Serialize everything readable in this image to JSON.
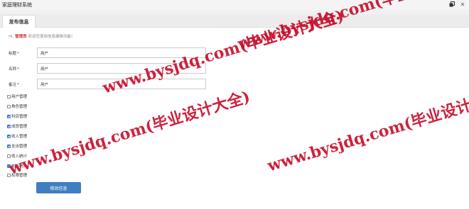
{
  "window": {
    "title": "家庭理财系统"
  },
  "tabs": [
    {
      "label": "发布信息"
    }
  ],
  "greeting": {
    "prefix": "Hi,",
    "username": "管理员",
    "suffix": "欢迎您使用信息编辑功能!"
  },
  "form": {
    "fields": [
      {
        "label": "标题",
        "required_mark": "*",
        "value": "用户"
      },
      {
        "label": "名称",
        "required_mark": "*",
        "value": "用户"
      },
      {
        "label": "备注",
        "required_mark": "*",
        "value": "用户"
      }
    ],
    "permissions": [
      {
        "label": "用户管理",
        "checked": false
      },
      {
        "label": "角色管理",
        "checked": false
      },
      {
        "label": "科目管理",
        "checked": true
      },
      {
        "label": "成员管理",
        "checked": true
      },
      {
        "label": "收入管理",
        "checked": true
      },
      {
        "label": "支出管理",
        "checked": true
      },
      {
        "label": "收入统计",
        "checked": false
      },
      {
        "label": "支出统计",
        "checked": true
      },
      {
        "label": "权限管理",
        "checked": false
      }
    ],
    "submit_label": "修改信息"
  },
  "watermark": {
    "text": "www.bysjdq.com(毕业设计大全)"
  }
}
